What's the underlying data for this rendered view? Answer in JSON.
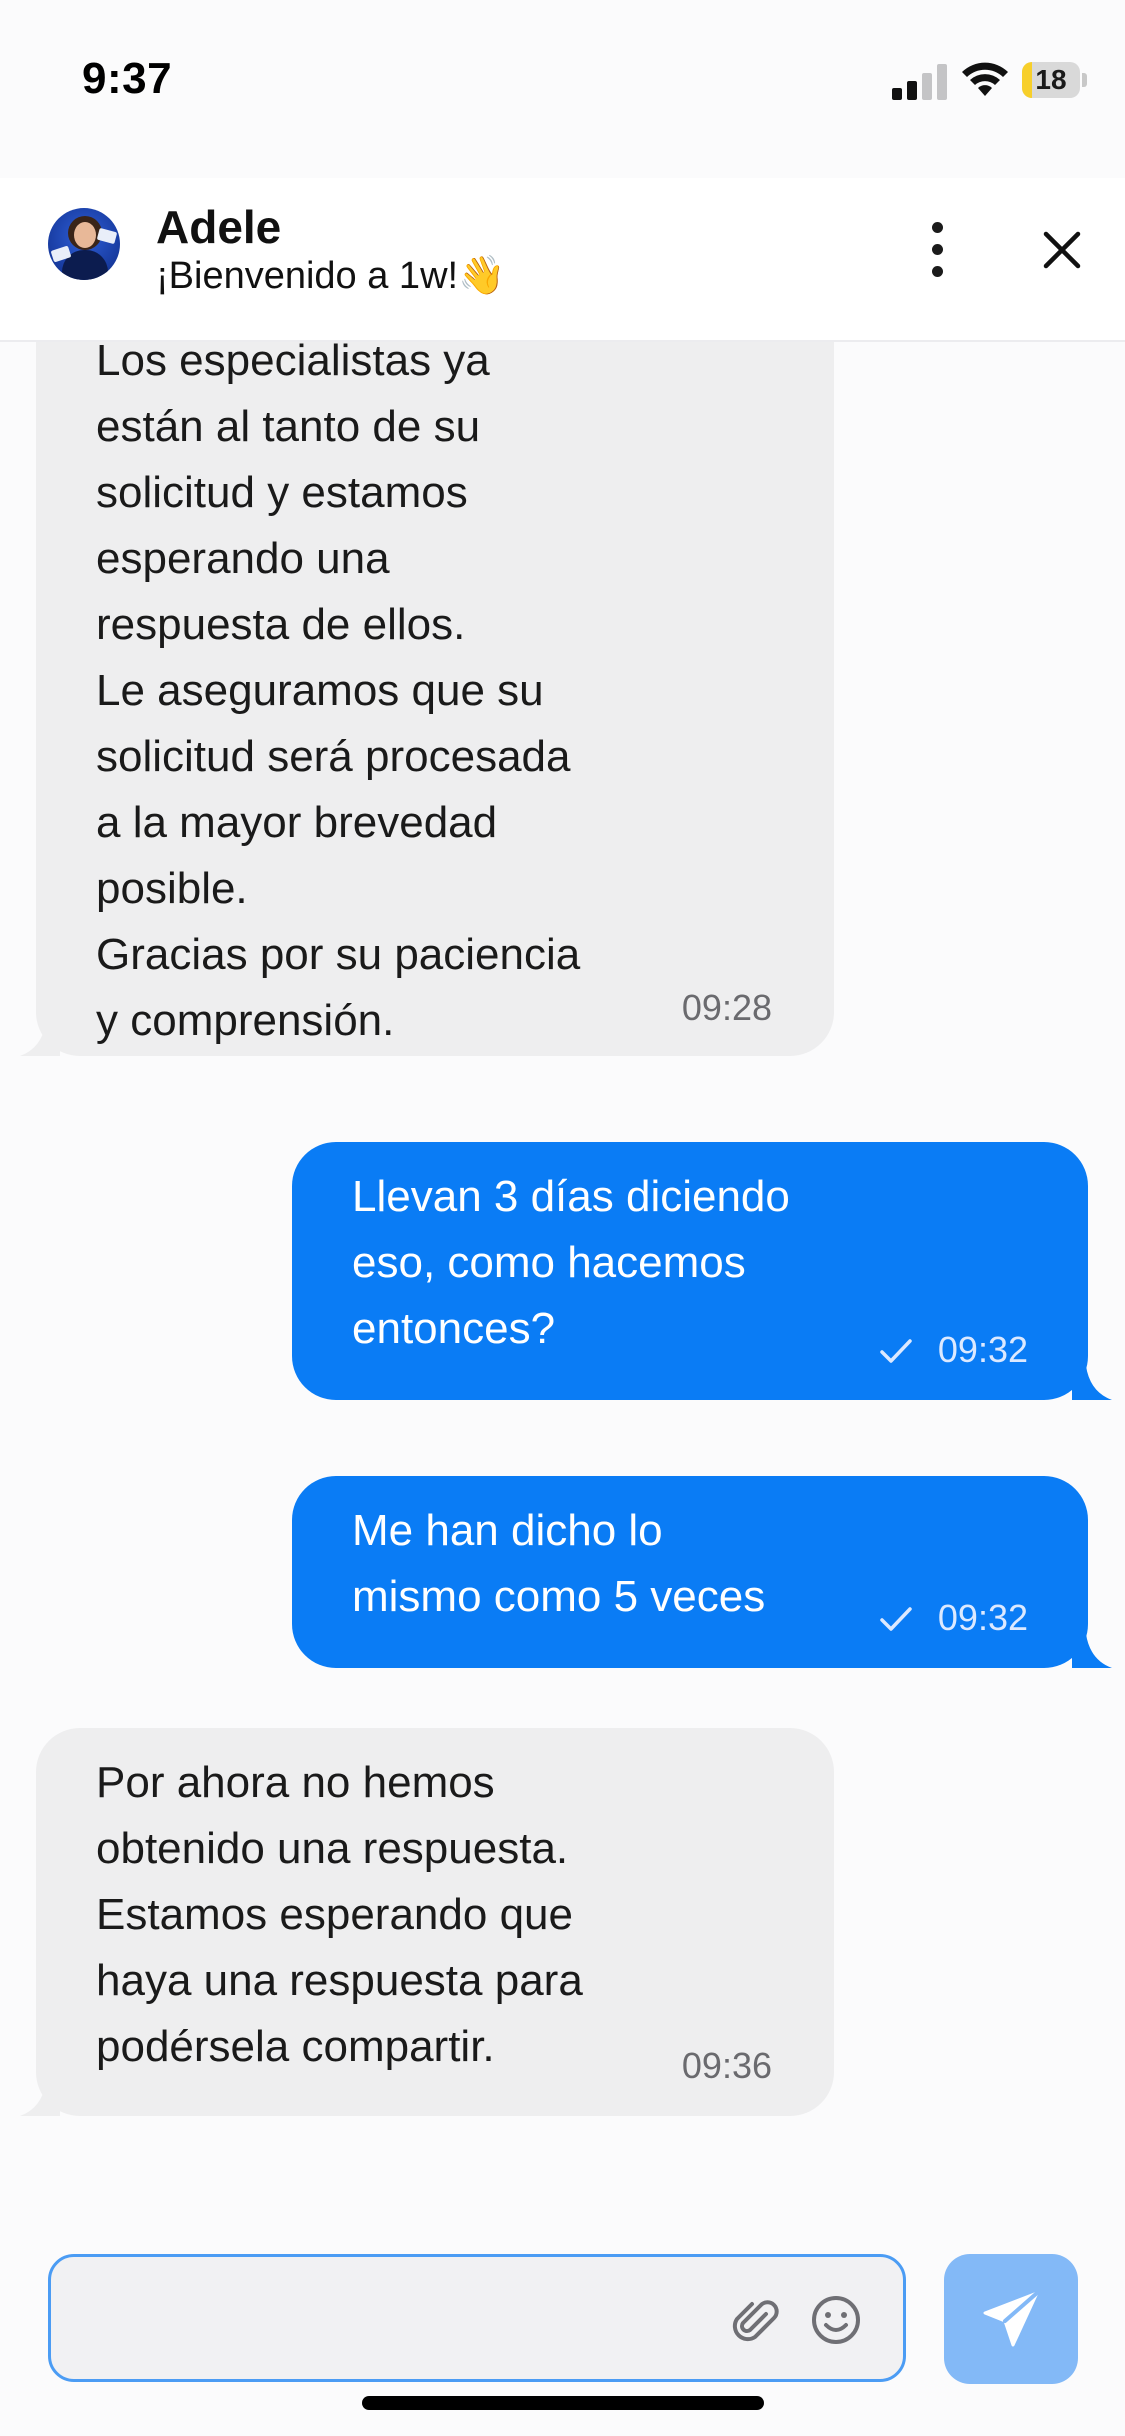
{
  "status_bar": {
    "time": "9:37",
    "battery_level": "18",
    "battery_fill_fraction": 0.18,
    "battery_color": "#f7cf2a",
    "icons": [
      "signal-icon",
      "wifi-icon",
      "battery-icon"
    ]
  },
  "header": {
    "contact_name": "Adele",
    "subtitle": "¡Bienvenido a 1w!👋",
    "icons": [
      "avatar",
      "more-vertical-icon",
      "close-icon"
    ]
  },
  "messages": [
    {
      "direction": "incoming",
      "text": "Los especialistas ya\nestán al tanto de su\nsolicitud y estamos\nesperando una\nrespuesta de ellos.\nLe aseguramos que su\nsolicitud será procesada\na la mayor brevedad\nposible.\nGracias por su paciencia\ny comprensión.",
      "time": "09:28"
    },
    {
      "direction": "outgoing",
      "text": "Llevan 3 días diciendo\neso, como hacemos\nentonces?",
      "time": "09:32",
      "status": "sent"
    },
    {
      "direction": "outgoing",
      "text": "Me han dicho lo\nmismo como 5 veces",
      "time": "09:32",
      "status": "sent"
    },
    {
      "direction": "incoming",
      "text": "Por ahora no hemos\nobtenido una respuesta.\nEstamos esperando que\nhaya una respuesta para\npodérsela compartir.",
      "time": "09:36"
    }
  ],
  "composer": {
    "input_value": "",
    "placeholder": "",
    "icons": [
      "paperclip-icon",
      "emoji-icon",
      "send-icon"
    ]
  },
  "colors": {
    "outgoing_bubble": "#0a7cf5",
    "incoming_bubble": "#eeeeef",
    "send_button": "#83b9f7",
    "input_border": "#4b9cf4"
  }
}
